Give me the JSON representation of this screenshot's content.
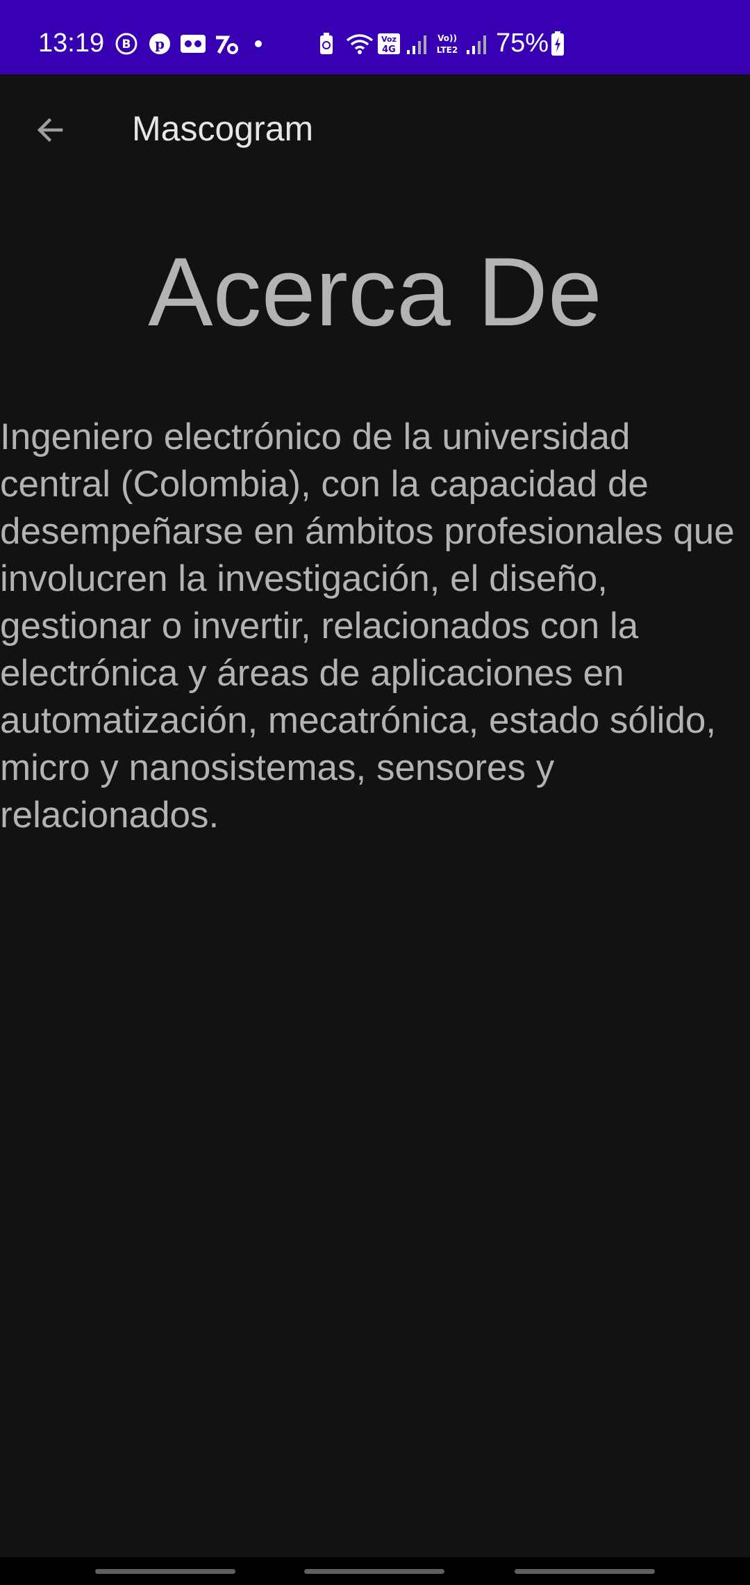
{
  "status_bar": {
    "time": "13:19",
    "battery_percent": "75%",
    "icons": [
      "b-messenger-icon",
      "pinterest-icon",
      "voicemail-icon",
      "app-icon",
      "notification-dot-icon",
      "battery-saver-icon",
      "wifi-icon",
      "volte-4g-icon",
      "signal-icon",
      "volte-lte2-icon",
      "signal-icon-2",
      "battery-charging-icon"
    ]
  },
  "app_bar": {
    "title": "Mascogram",
    "back_icon": "arrow-back-icon"
  },
  "content": {
    "heading": "Acerca De",
    "description": "Ingeniero electrónico de la universidad central (Colombia), con la capacidad de desempeñarse en ámbitos profesionales que involucren la investigación, el diseño, gestionar o invertir, relacionados con la electrónica y áreas de aplicaciones en automatización, mecatrónica, estado sólido, micro y nanosistemas, sensores y relacionados."
  },
  "colors": {
    "status_bar": "#3700b3",
    "background": "#121212",
    "text_primary": "#e6e6e6",
    "text_secondary": "#b3b3b3"
  }
}
